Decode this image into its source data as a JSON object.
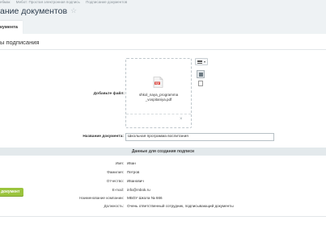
{
  "breadcrumb": [
    "ебмак",
    "Мебот: Простая электронная подпись",
    "Подписание документов"
  ],
  "page": {
    "title": "ание документов",
    "star": "☆"
  },
  "tab": {
    "label": "кумента"
  },
  "section": {
    "title": "ы подписания"
  },
  "upload": {
    "label": "Добавьте файл:",
    "file_name_line1": "shkol_naya_programma",
    "file_name_line2": "_vospitaniya.pdf",
    "file_badge": "PDF",
    "remove": "×",
    "menu_caret": "▾"
  },
  "doc_name": {
    "label": "Название документа:",
    "value": "Школьная программа воспитания"
  },
  "signature": {
    "heading": "Данные для создания подписи",
    "fields": [
      {
        "label": "Имя:",
        "value": "Иван"
      },
      {
        "label": "Фамилия:",
        "value": "Петров"
      },
      {
        "label": "Отчество:",
        "value": "Иванович"
      },
      {
        "label": "E-mail:",
        "value": "info@mbok.ru"
      },
      {
        "label": "Наименование компании:",
        "value": "МБОУ Школа № 666"
      },
      {
        "label": "Должность:",
        "value": "Очень ответственный сотрудник, подписывающий документы"
      }
    ]
  },
  "submit": {
    "label": "документ"
  },
  "colors": {
    "accent_green": "#9bc43d",
    "band": "#e3e9ec",
    "pdf_red": "#d9453d"
  }
}
